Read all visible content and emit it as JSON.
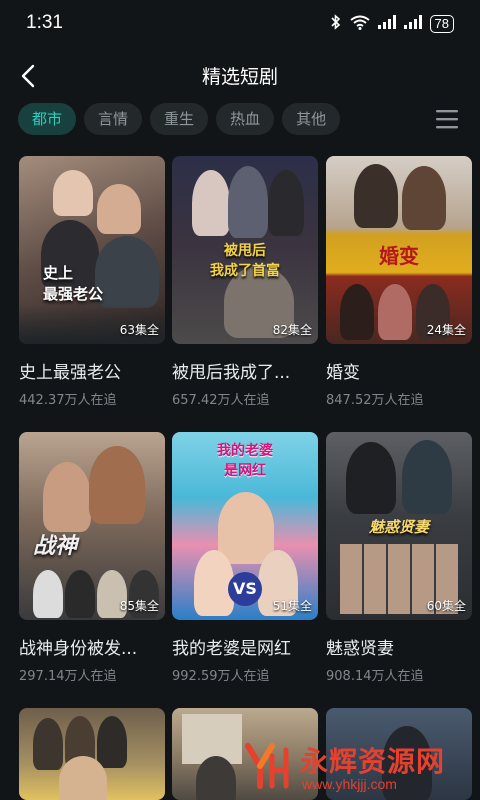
{
  "status": {
    "time": "1:31",
    "battery": "78"
  },
  "header": {
    "title": "精选短剧"
  },
  "tabs": [
    {
      "label": "都市",
      "active": true
    },
    {
      "label": "言情",
      "active": false
    },
    {
      "label": "重生",
      "active": false
    },
    {
      "label": "热血",
      "active": false
    },
    {
      "label": "其他",
      "active": false
    }
  ],
  "dramas": [
    {
      "title": "史上最强老公",
      "episodes": "63集全",
      "views": "442.37万人在追",
      "poster_text": "史上\n最强老公"
    },
    {
      "title": "被甩后我成了...",
      "episodes": "82集全",
      "views": "657.42万人在追",
      "poster_text": "被甩后\n我成了首富"
    },
    {
      "title": "婚变",
      "episodes": "24集全",
      "views": "847.52万人在追",
      "poster_text": "婚变"
    },
    {
      "title": "战神身份被发...",
      "episodes": "85集全",
      "views": "297.14万人在追",
      "poster_text": "战神"
    },
    {
      "title": "我的老婆是网红",
      "episodes": "51集全",
      "views": "992.59万人在追",
      "poster_text": "我的老婆\n是网红"
    },
    {
      "title": "魅惑贤妻",
      "episodes": "60集全",
      "views": "908.14万人在追",
      "poster_text": "魅惑贤妻"
    }
  ],
  "watermark": {
    "title": "永辉资源网",
    "url": "www.yhkjjj.com"
  }
}
